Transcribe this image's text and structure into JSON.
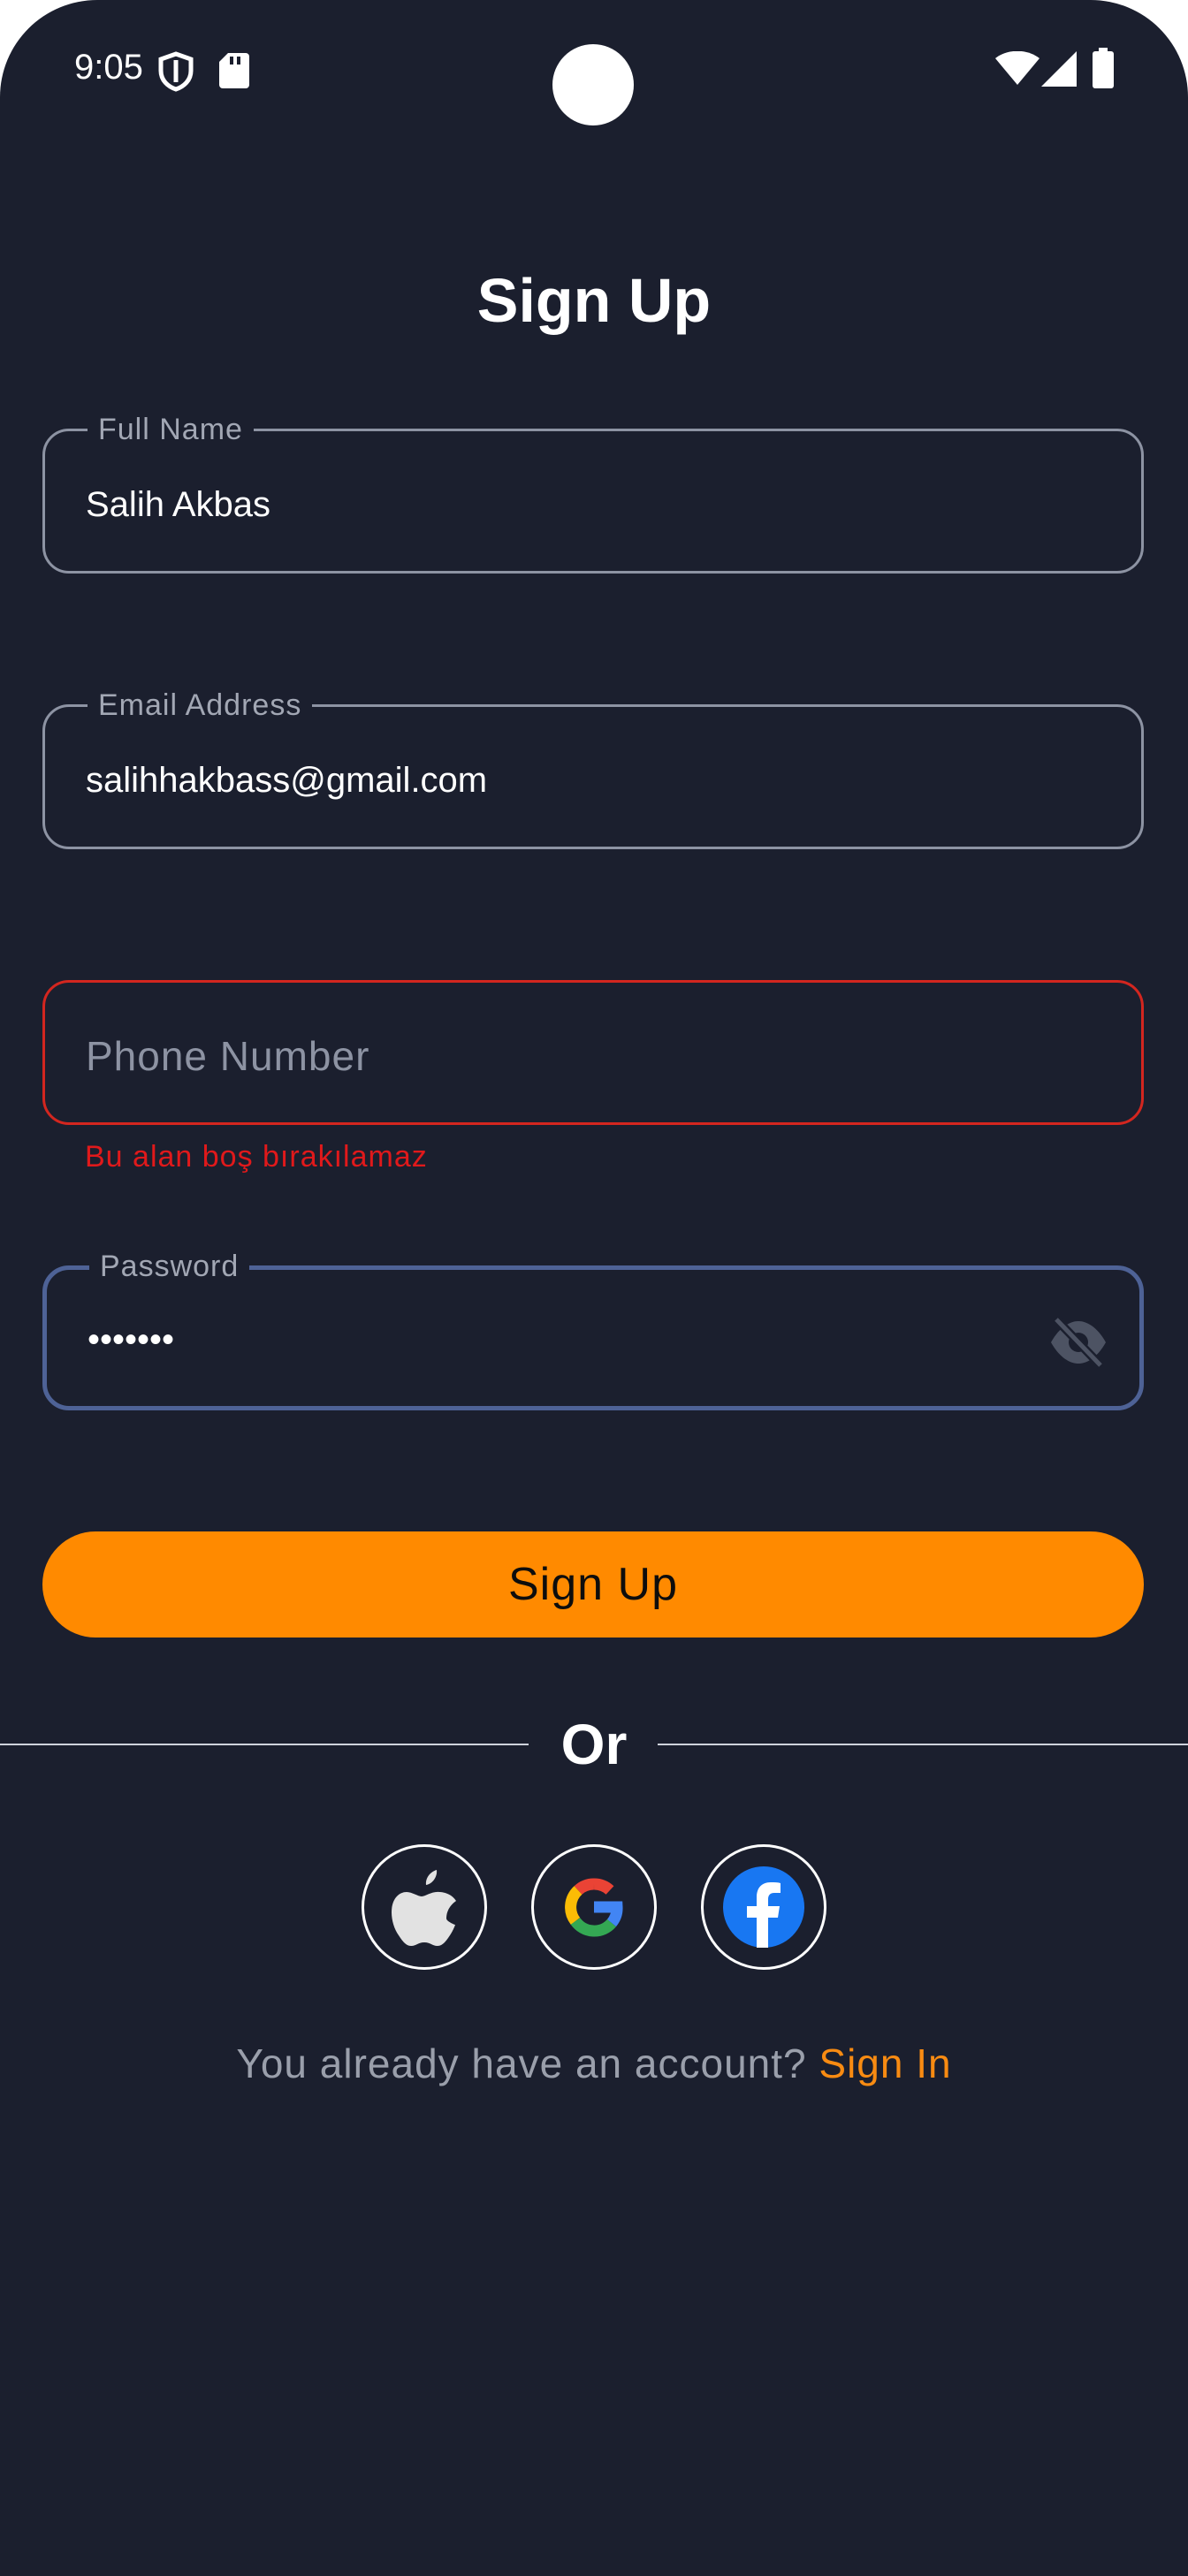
{
  "status_bar": {
    "time": "9:05",
    "icons": [
      "shield-icon",
      "sd-card-icon",
      "wifi-icon",
      "signal-icon",
      "battery-icon"
    ]
  },
  "page": {
    "title": "Sign Up"
  },
  "form": {
    "full_name": {
      "label": "Full Name",
      "value": "Salih Akbas"
    },
    "email": {
      "label": "Email Address",
      "value": "salihhakbass@gmail.com"
    },
    "phone": {
      "placeholder": "Phone Number",
      "value": "",
      "error": "Bu alan boş bırakılamaz"
    },
    "password": {
      "label": "Password",
      "value": "•••••••",
      "toggle_icon": "eye-off-icon"
    }
  },
  "primary_button": {
    "label": "Sign Up"
  },
  "divider": {
    "label": "Or"
  },
  "social_logins": [
    "apple-icon",
    "google-icon",
    "facebook-icon"
  ],
  "footer": {
    "prompt": "You already have an account?",
    "link": "Sign In"
  },
  "colors": {
    "background": "#1b1f2e",
    "accent": "#ff8a00",
    "error": "#d3261f",
    "focus": "#4e6296"
  }
}
